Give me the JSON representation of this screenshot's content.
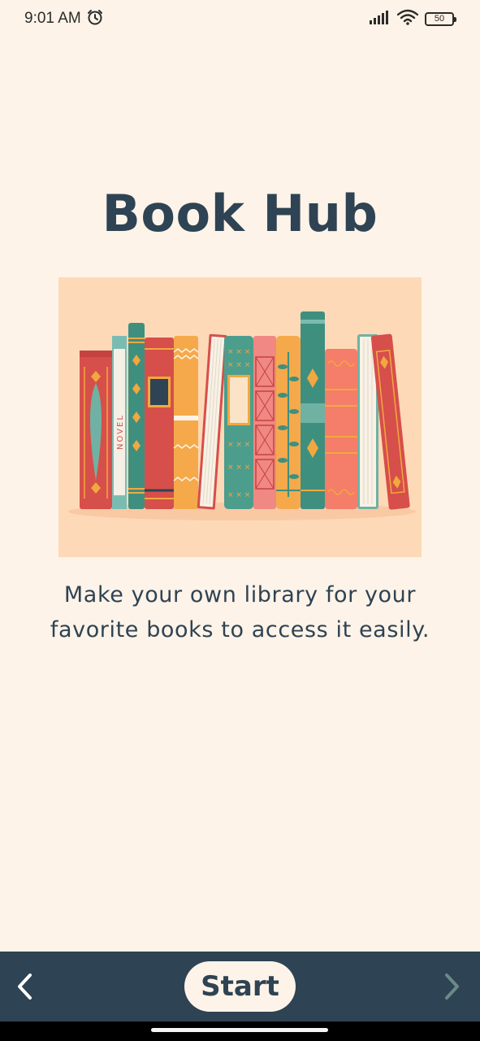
{
  "status_bar": {
    "time": "9:01 AM",
    "battery_level": "50",
    "icons": [
      "alarm-icon",
      "signal-icon",
      "wifi-icon",
      "battery-icon"
    ]
  },
  "app": {
    "title": "Book Hub",
    "description": "Make your own library for your favorite books to access it easily."
  },
  "illustration": {
    "spine_text": "NOVEL",
    "icon": "books-on-shelf-illustration"
  },
  "bottom_nav": {
    "start_label": "Start",
    "prev_icon": "chevron-left-icon",
    "next_icon": "chevron-right-icon"
  },
  "colors": {
    "background": "#fef3e8",
    "primary": "#2e4353",
    "illustration_bg": "#fdd9b7"
  }
}
